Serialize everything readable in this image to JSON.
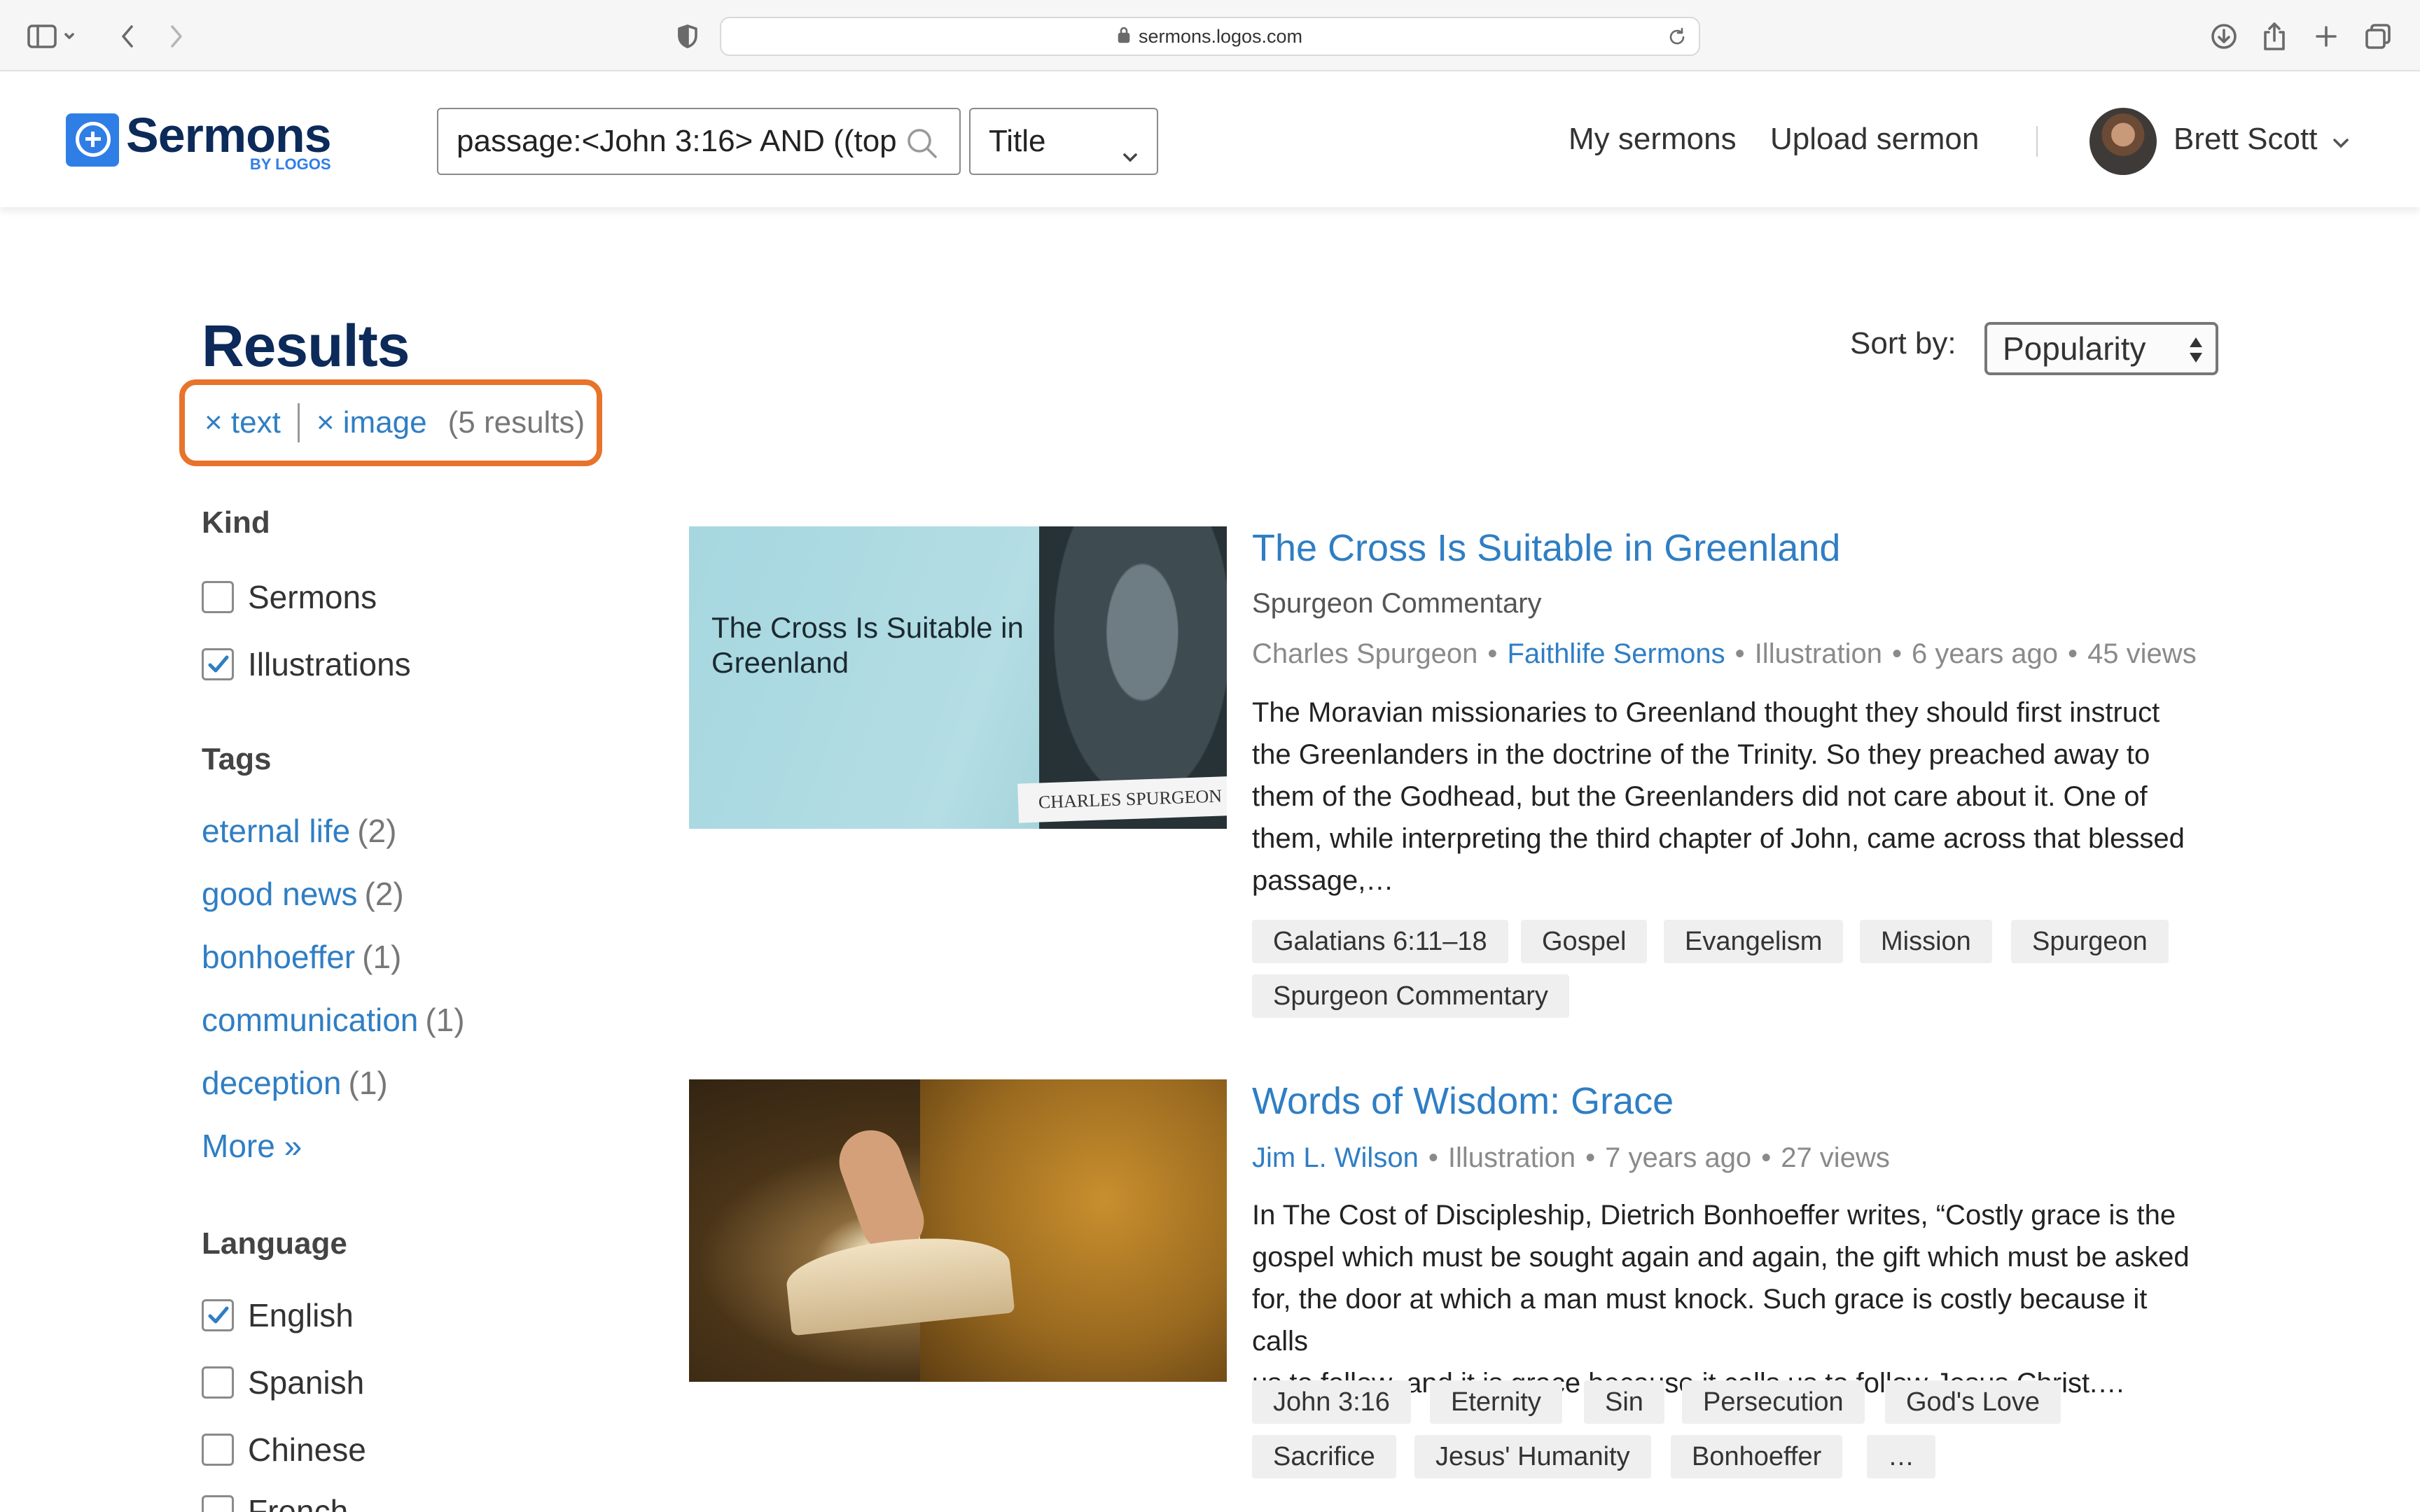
{
  "browser": {
    "url": "sermons.logos.com"
  },
  "header": {
    "logo_title": "Sermons",
    "logo_sub": "BY LOGOS",
    "search_value": "passage:<John 3:16> AND ((top",
    "search_scope": "Title",
    "nav": {
      "my_sermons": "My sermons",
      "upload": "Upload sermon"
    },
    "user_name": "Brett Scott"
  },
  "results": {
    "title": "Results",
    "filters": {
      "chip1": "× text",
      "chip2": "× image",
      "count": "(5 results)"
    },
    "sort_label": "Sort by:",
    "sort_value": "Popularity"
  },
  "sidebar": {
    "kind": {
      "heading": "Kind",
      "items": [
        {
          "label": "Sermons",
          "checked": false
        },
        {
          "label": "Illustrations",
          "checked": true
        }
      ]
    },
    "tags": {
      "heading": "Tags",
      "items": [
        {
          "name": "eternal life",
          "count": "(2)"
        },
        {
          "name": "good news",
          "count": "(2)"
        },
        {
          "name": "bonhoeffer",
          "count": "(1)"
        },
        {
          "name": "communication",
          "count": "(1)"
        },
        {
          "name": "deception",
          "count": "(1)"
        }
      ],
      "more": "More »"
    },
    "language": {
      "heading": "Language",
      "items": [
        {
          "label": "English",
          "checked": true
        },
        {
          "label": "Spanish",
          "checked": false
        },
        {
          "label": "Chinese",
          "checked": false
        },
        {
          "label": "French",
          "checked": false
        }
      ]
    }
  },
  "cards": [
    {
      "thumb_title": "The Cross Is Suitable in Greenland",
      "thumb_banner": "CHARLES SPURGEON",
      "title": "The Cross Is Suitable in Greenland",
      "source": "Spurgeon Commentary",
      "author": "Charles Spurgeon",
      "channel": "Faithlife Sermons",
      "kind": "Illustration",
      "age": "6 years ago",
      "views": "45 views",
      "desc_lines": [
        "The Moravian missionaries to Greenland thought they should first instruct",
        "the Greenlanders in the doctrine of the Trinity. So they preached away to",
        "them of the Godhead, but the Greenlanders did not care about it. One of",
        "them, while interpreting the third chapter of John, came across that blessed",
        "passage,…"
      ],
      "tags": [
        "Galatians 6:11–18",
        "Gospel",
        "Evangelism",
        "Mission",
        "Spurgeon",
        "Spurgeon Commentary"
      ]
    },
    {
      "title": "Words of Wisdom: Grace",
      "author": "Jim L. Wilson",
      "kind": "Illustration",
      "age": "7 years ago",
      "views": "27 views",
      "desc_lines": [
        "In The Cost of Discipleship, Dietrich Bonhoeffer writes, “Costly grace is the",
        "gospel which must be sought again and again, the gift which must be asked",
        "for, the door at which a man must knock. Such grace is costly because it calls",
        "us to follow, and it is grace because it calls us to follow Jesus Christ.…"
      ],
      "tags": [
        "John 3:16",
        "Eternity",
        "Sin",
        "Persecution",
        "God's Love",
        "Sacrifice",
        "Jesus' Humanity",
        "Bonhoeffer",
        "…"
      ]
    }
  ],
  "colors": {
    "brand_navy": "#0c2a5a",
    "link_blue": "#2f7ec4",
    "logo_blue": "#2f7ee6",
    "highlight_orange": "#e8732a"
  }
}
